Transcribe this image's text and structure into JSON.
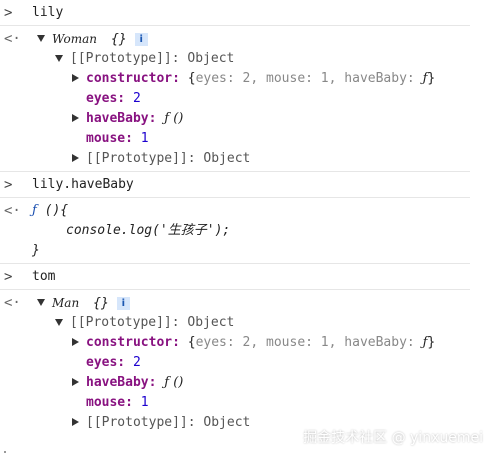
{
  "console": {
    "prompt_glyph": ">",
    "result_glyph": "<·",
    "entries": [
      {
        "input": "lily",
        "class_name": "Woman",
        "braces": "{}",
        "info": "i",
        "proto_label": "[[Prototype]]: Object",
        "constructor_key": "constructor:",
        "constructor_preview_open": "{",
        "constructor_preview_eyes": "eyes: 2, mouse: 1, haveBaby: ",
        "constructor_preview_f": "ƒ",
        "constructor_preview_close": "}",
        "eyes_key": "eyes:",
        "eyes_val": "2",
        "haveBaby_key": "haveBaby:",
        "haveBaby_val": "ƒ ()",
        "mouse_key": "mouse:",
        "mouse_val": "1",
        "inner_proto_label": "[[Prototype]]: Object"
      },
      {
        "input": "lily.haveBaby",
        "func_head_f": "ƒ",
        "func_head_rest": " (){",
        "func_body": "console.log('生孩子');",
        "func_close": "}"
      },
      {
        "input": "tom",
        "class_name": "Man",
        "braces": "{}",
        "info": "i",
        "proto_label": "[[Prototype]]: Object",
        "constructor_key": "constructor:",
        "constructor_preview_open": "{",
        "constructor_preview_eyes": "eyes: 2, mouse: 1, haveBaby: ",
        "constructor_preview_f": "ƒ",
        "constructor_preview_close": "}",
        "eyes_key": "eyes:",
        "eyes_val": "2",
        "haveBaby_key": "haveBaby:",
        "haveBaby_val": "ƒ ()",
        "mouse_key": "mouse:",
        "mouse_val": "1",
        "inner_proto_label": "[[Prototype]]: Object"
      }
    ]
  },
  "watermark": "掘金技术社区 @ yinxuemei"
}
